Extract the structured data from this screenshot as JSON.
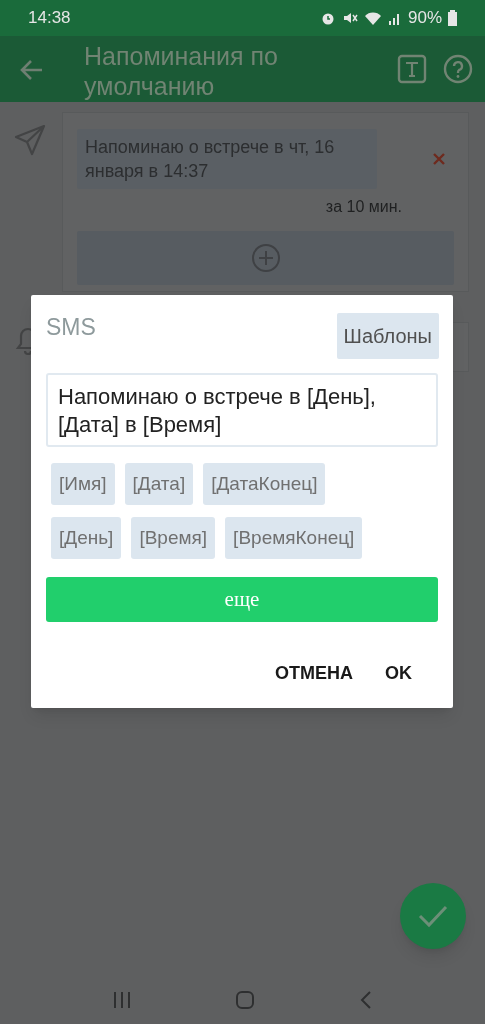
{
  "status_bar": {
    "time": "14:38",
    "battery": "90%"
  },
  "app_bar": {
    "title": "Напоминания по умолчанию"
  },
  "reminder_card": {
    "message": "Напоминаю о встрече в чт, 16 января в 14:37",
    "offset": "за 10 мин."
  },
  "dialog": {
    "title": "SMS",
    "templates_button": "Шаблоны",
    "message": "Напоминаю о встрече в [День], [Дата] в [Время]",
    "tokens": [
      "[Имя]",
      "[Дата]",
      "[ДатаКонец]",
      "[День]",
      "[Время]",
      "[ВремяКонец]"
    ],
    "more_button": "еще",
    "actions": [
      "ОТМЕНА",
      "OK"
    ]
  }
}
